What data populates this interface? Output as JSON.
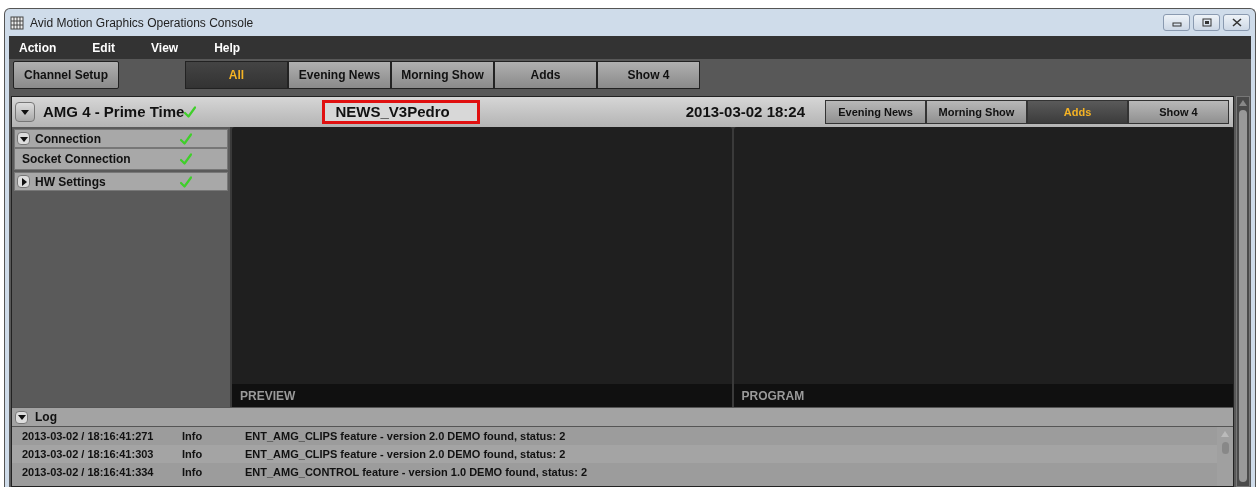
{
  "window": {
    "title": "Avid Motion Graphics Operations Console"
  },
  "menu": [
    "Action",
    "Edit",
    "View",
    "Help"
  ],
  "toolbar": {
    "setup_button": "Channel Setup",
    "filters": [
      {
        "label": "All",
        "selected": true
      },
      {
        "label": "Evening News",
        "selected": false
      },
      {
        "label": "Morning Show",
        "selected": false
      },
      {
        "label": "Adds",
        "selected": false
      },
      {
        "label": "Show 4",
        "selected": false
      }
    ]
  },
  "channel": {
    "name": "AMG 4 -  Prime Time",
    "ok": true,
    "expanded": true,
    "scene": "NEWS_V3Pedro",
    "scene_highlighted": true,
    "datetime": "2013-03-02 18:24",
    "shows": [
      {
        "label": "Evening News",
        "selected": false
      },
      {
        "label": "Morning Show",
        "selected": false
      },
      {
        "label": "Adds",
        "selected": true
      },
      {
        "label": "Show 4",
        "selected": false
      }
    ]
  },
  "tree": [
    {
      "label": "Connection",
      "ok": true,
      "expanded": true,
      "children": [
        {
          "label": "Socket Connection",
          "ok": true
        }
      ]
    },
    {
      "label": "HW Settings",
      "ok": true,
      "expanded": false
    }
  ],
  "monitors": [
    {
      "label": "PREVIEW"
    },
    {
      "label": "PROGRAM"
    }
  ],
  "log": {
    "title": "Log",
    "expanded": true,
    "rows": [
      {
        "time": "2013-03-02 / 18:16:41:271",
        "level": "Info",
        "message": "ENT_AMG_CLIPS feature - version 2.0 DEMO found, status: 2"
      },
      {
        "time": "2013-03-02 / 18:16:41:303",
        "level": "Info",
        "message": "ENT_AMG_CLIPS feature - version 2.0 DEMO found, status: 2"
      },
      {
        "time": "2013-03-02 / 18:16:41:334",
        "level": "Info",
        "message": "ENT_AMG_CONTROL feature - version 1.0 DEMO found, status: 2"
      }
    ]
  }
}
